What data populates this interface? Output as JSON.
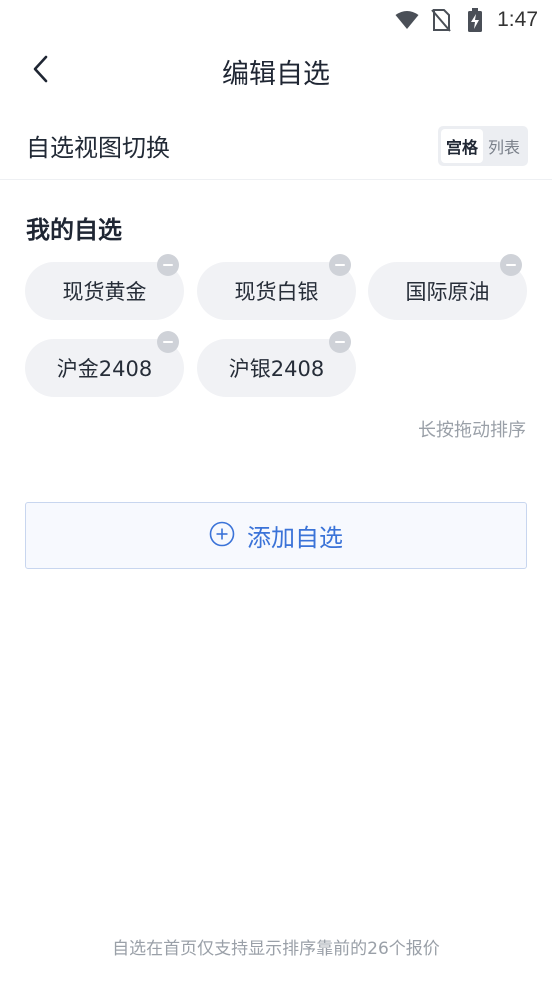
{
  "status_bar": {
    "time": "1:47",
    "icons": [
      "wifi-icon",
      "no-sim-icon",
      "battery-charging-icon"
    ]
  },
  "header": {
    "title": "编辑自选",
    "back_icon": "chevron-left-icon"
  },
  "view_switch": {
    "label": "自选视图切换",
    "options": [
      "宫格",
      "列表"
    ],
    "selected": "宫格"
  },
  "watchlist": {
    "title": "我的自选",
    "items": [
      {
        "name": "现货黄金"
      },
      {
        "name": "现货白银"
      },
      {
        "name": "国际原油"
      },
      {
        "name": "沪金2408"
      },
      {
        "name": "沪银2408"
      }
    ],
    "sort_hint": "长按拖动排序"
  },
  "add_button": {
    "label": "添加自选",
    "icon": "plus-circle-icon"
  },
  "footer_note": "自选在首页仅支持显示排序靠前的26个报价",
  "colors": {
    "accent": "#3b73d8",
    "chip_bg": "#f1f2f5",
    "remove_badge": "#cfd2d8"
  }
}
